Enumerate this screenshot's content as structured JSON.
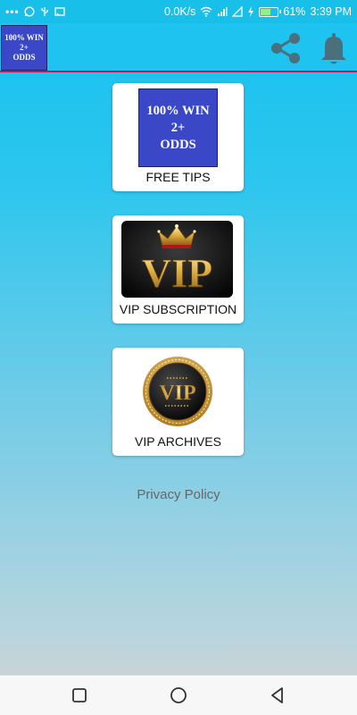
{
  "status_bar": {
    "speed": "0.0K/s",
    "battery": "61%",
    "time": "3:39 PM"
  },
  "app_bar": {
    "logo_text": "100% WIN\n2+\nODDS",
    "share_icon": "share-icon",
    "bell_icon": "bell-icon",
    "accent_color": "#1fc3ef",
    "divider_color": "#c2185b"
  },
  "cards": {
    "free_tips": {
      "image_text": "100% WIN\n2+\nODDS",
      "label": "FREE TIPS"
    },
    "vip_subscription": {
      "image_text": "VIP",
      "label": "VIP SUBSCRIPTION"
    },
    "vip_archives": {
      "image_text": "VIP",
      "label": "VIP ARCHIVES"
    }
  },
  "privacy_policy": "Privacy Policy",
  "nav_bar": {
    "icons": [
      "recent-apps-icon",
      "home-icon",
      "back-icon"
    ]
  }
}
